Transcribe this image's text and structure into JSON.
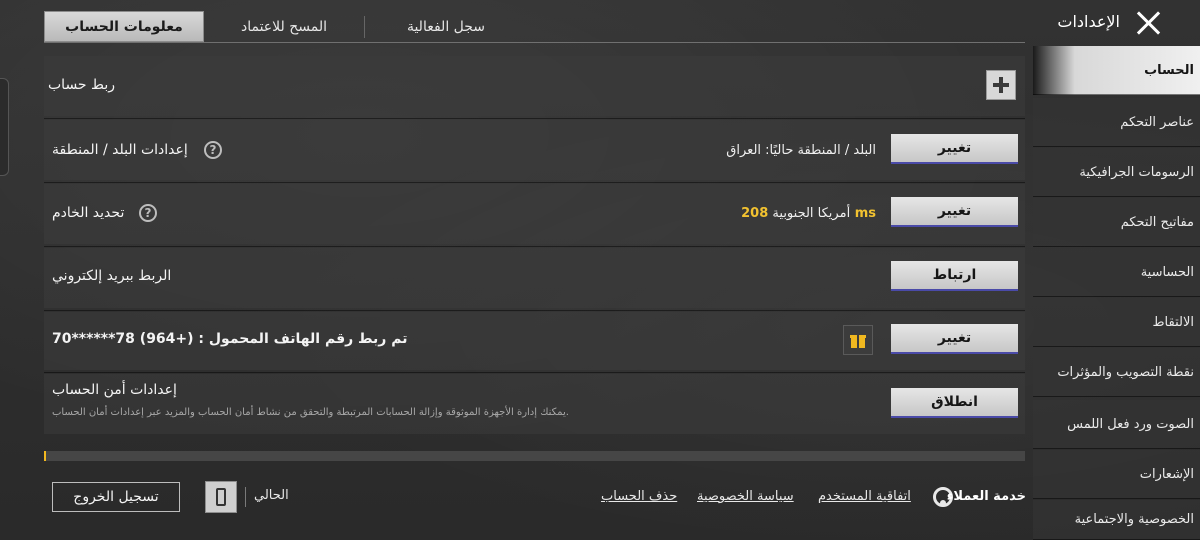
{
  "header": {
    "title": "الإعدادات",
    "tabs": [
      {
        "label": "معلومات الحساب",
        "active": true
      },
      {
        "label": "المسح للاعتماد",
        "active": false
      },
      {
        "label": "سجل الفعالية",
        "active": false
      }
    ]
  },
  "sidebar": {
    "items": [
      {
        "label": "الحساب",
        "active": true
      },
      {
        "label": "عناصر التحكم",
        "active": false
      },
      {
        "label": "الرسومات الجرافيكية",
        "active": false
      },
      {
        "label": "مفاتيح التحكم",
        "active": false
      },
      {
        "label": "الحساسية",
        "active": false
      },
      {
        "label": "الالتقاط",
        "active": false
      },
      {
        "label": "نقطة التصويب والمؤثرات",
        "active": false
      },
      {
        "label": "الصوت ورد فعل اللمس",
        "active": false
      },
      {
        "label": "الإشعارات",
        "active": false
      },
      {
        "label": "الخصوصية والاجتماعية",
        "active": false
      }
    ]
  },
  "main": {
    "link_account": {
      "label": "ربط حساب"
    },
    "country_region": {
      "label": "إعدادات البلد / المنطقة",
      "value": "البلد / المنطقة حاليًا: العراق",
      "button": "تغيير"
    },
    "server": {
      "label": "تحديد الخادم",
      "value": "أمريكا الجنوبية",
      "ping": "208 ms",
      "button": "تغيير"
    },
    "email": {
      "label": "الربط ببريد إلكتروني",
      "button": "ارتباط"
    },
    "phone": {
      "label": "تم ربط رقم الهاتف المحمول : (+964) 78******70",
      "button": "تغيير"
    },
    "security": {
      "label": "إعدادات أمن الحساب",
      "description": "يمكنك إدارة الأجهزة الموثوقة وإزالة الحسابات المرتبطة والتحقق من نشاط أمان الحساب والمزيد عبر إعدادات أمان الحساب.",
      "button": "انطلاق"
    }
  },
  "footer": {
    "logout": "تسجيل الخروج",
    "current": "الحالي",
    "delete_account": "حذف الحساب",
    "privacy_policy": "سياسة الخصوصية",
    "user_agreement": "اتفاقية المستخدم",
    "customer_service": "خدمة العملاء"
  },
  "colors": {
    "accent_button_border": "#4a4aa8",
    "ping": "#f2c230",
    "scroll_thumb": "#f2b820"
  }
}
